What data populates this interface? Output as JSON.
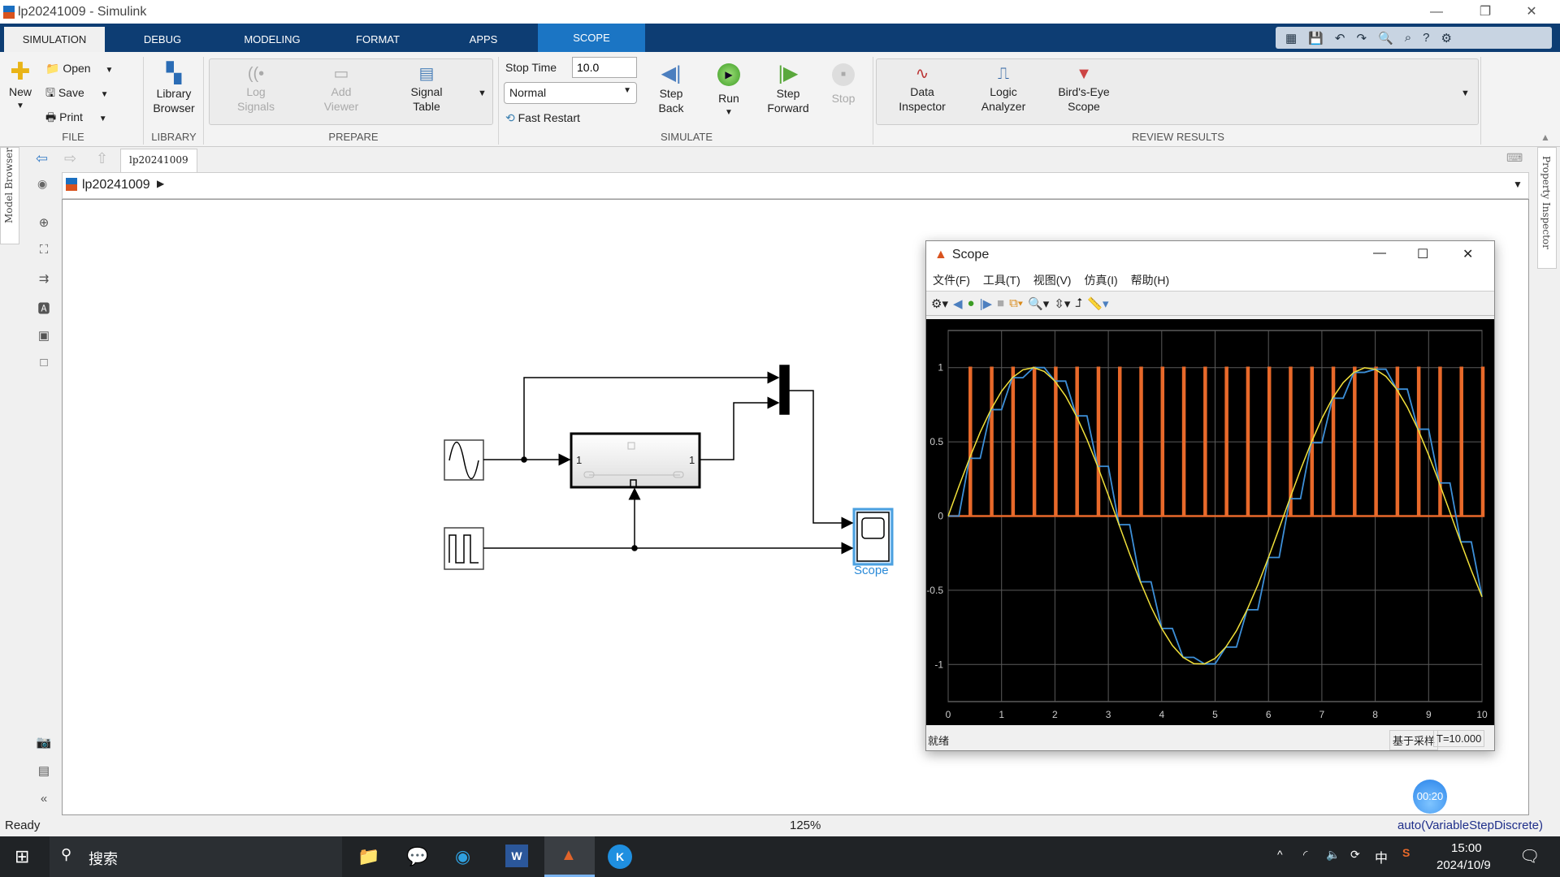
{
  "window": {
    "title": "lp20241009 - Simulink"
  },
  "tabs": [
    {
      "label": "SIMULATION"
    },
    {
      "label": "DEBUG"
    },
    {
      "label": "MODELING"
    },
    {
      "label": "FORMAT"
    },
    {
      "label": "APPS"
    },
    {
      "label": "SCOPE"
    }
  ],
  "ribbon": {
    "file": {
      "new": "New",
      "open": "Open",
      "save": "Save",
      "print": "Print",
      "group": "FILE"
    },
    "library": {
      "browser": "Library\nBrowser",
      "group": "LIBRARY"
    },
    "prepare": {
      "log": "Log\nSignals",
      "add": "Add\nViewer",
      "signal_table": "Signal\nTable",
      "group": "PREPARE"
    },
    "simulate": {
      "stop_time_label": "Stop Time",
      "stop_time": "10.0",
      "mode": "Normal",
      "fast_restart": "Fast Restart",
      "step_back": "Step\nBack",
      "run": "Run",
      "step_forward": "Step\nForward",
      "stop": "Stop",
      "group": "SIMULATE"
    },
    "review": {
      "data_inspector": "Data\nInspector",
      "logic_analyzer": "Logic\nAnalyzer",
      "birds_eye": "Bird's-Eye\nScope",
      "group": "REVIEW RESULTS"
    }
  },
  "nav": {
    "tab": "lp20241009",
    "breadcrumb": "lp20241009"
  },
  "side": {
    "model_browser": "Model Browser",
    "property_inspector": "Property Inspector"
  },
  "diagram": {
    "scope_label": "Scope",
    "subsystem_in": "1",
    "subsystem_out": "1"
  },
  "status": {
    "left": "Ready",
    "zoom": "125%",
    "solver": "auto(VariableStepDiscrete)"
  },
  "recorder": {
    "time": "00:20"
  },
  "taskbar": {
    "search": "搜索",
    "time": "15:00",
    "date": "2024/10/9",
    "ime": "中"
  },
  "scope": {
    "title": "Scope",
    "menu": [
      "文件(F)",
      "工具(T)",
      "视图(V)",
      "仿真(I)",
      "帮助(H)"
    ],
    "status_left": "就绪",
    "status_mode": "基于采样",
    "status_time": "T=10.000",
    "colors": {
      "background": "#000000",
      "grid": "#5a5a5a",
      "sine": "#f2e13a",
      "held": "#3d8fd8",
      "pulse": "#e8692a"
    }
  },
  "chart_data": {
    "type": "line",
    "xlim": [
      0,
      10
    ],
    "ylim": [
      -1.25,
      1.25
    ],
    "grid": true,
    "xticks": [
      "0",
      "1",
      "2",
      "3",
      "4",
      "5",
      "6",
      "7",
      "8",
      "9",
      "10"
    ],
    "yticks": [
      "1",
      "0.5",
      "0",
      "-0.5",
      "-1"
    ],
    "series": [
      {
        "color": "#f2e13a",
        "x_step": 0.2,
        "values": [
          0,
          0.199,
          0.389,
          0.565,
          0.717,
          0.841,
          0.932,
          0.985,
          1.0,
          0.974,
          0.909,
          0.808,
          0.675,
          0.516,
          0.335,
          0.141,
          -0.058,
          -0.256,
          -0.443,
          -0.612,
          -0.757,
          -0.872,
          -0.952,
          -0.994,
          -0.996,
          -0.959,
          -0.883,
          -0.773,
          -0.631,
          -0.465,
          -0.279,
          -0.083,
          0.117,
          0.312,
          0.494,
          0.657,
          0.794,
          0.899,
          0.968,
          0.999,
          0.989,
          0.941,
          0.855,
          0.734,
          0.585,
          0.412,
          0.223,
          0.025,
          -0.174,
          -0.366,
          -0.544
        ]
      },
      {
        "color": "#3d8fd8",
        "sample_period": 0.4,
        "values": [
          0,
          0.389,
          0.717,
          0.932,
          1.0,
          0.909,
          0.675,
          0.335,
          -0.058,
          -0.443,
          -0.757,
          -0.952,
          -0.996,
          -0.883,
          -0.631,
          -0.279,
          0.117,
          0.494,
          0.794,
          0.968,
          0.989,
          0.855,
          0.585,
          0.223,
          -0.174,
          -0.544
        ]
      },
      {
        "color": "#e8692a",
        "type": "pulse",
        "period": 0.4,
        "amplitude": 1,
        "low": 0
      }
    ]
  }
}
